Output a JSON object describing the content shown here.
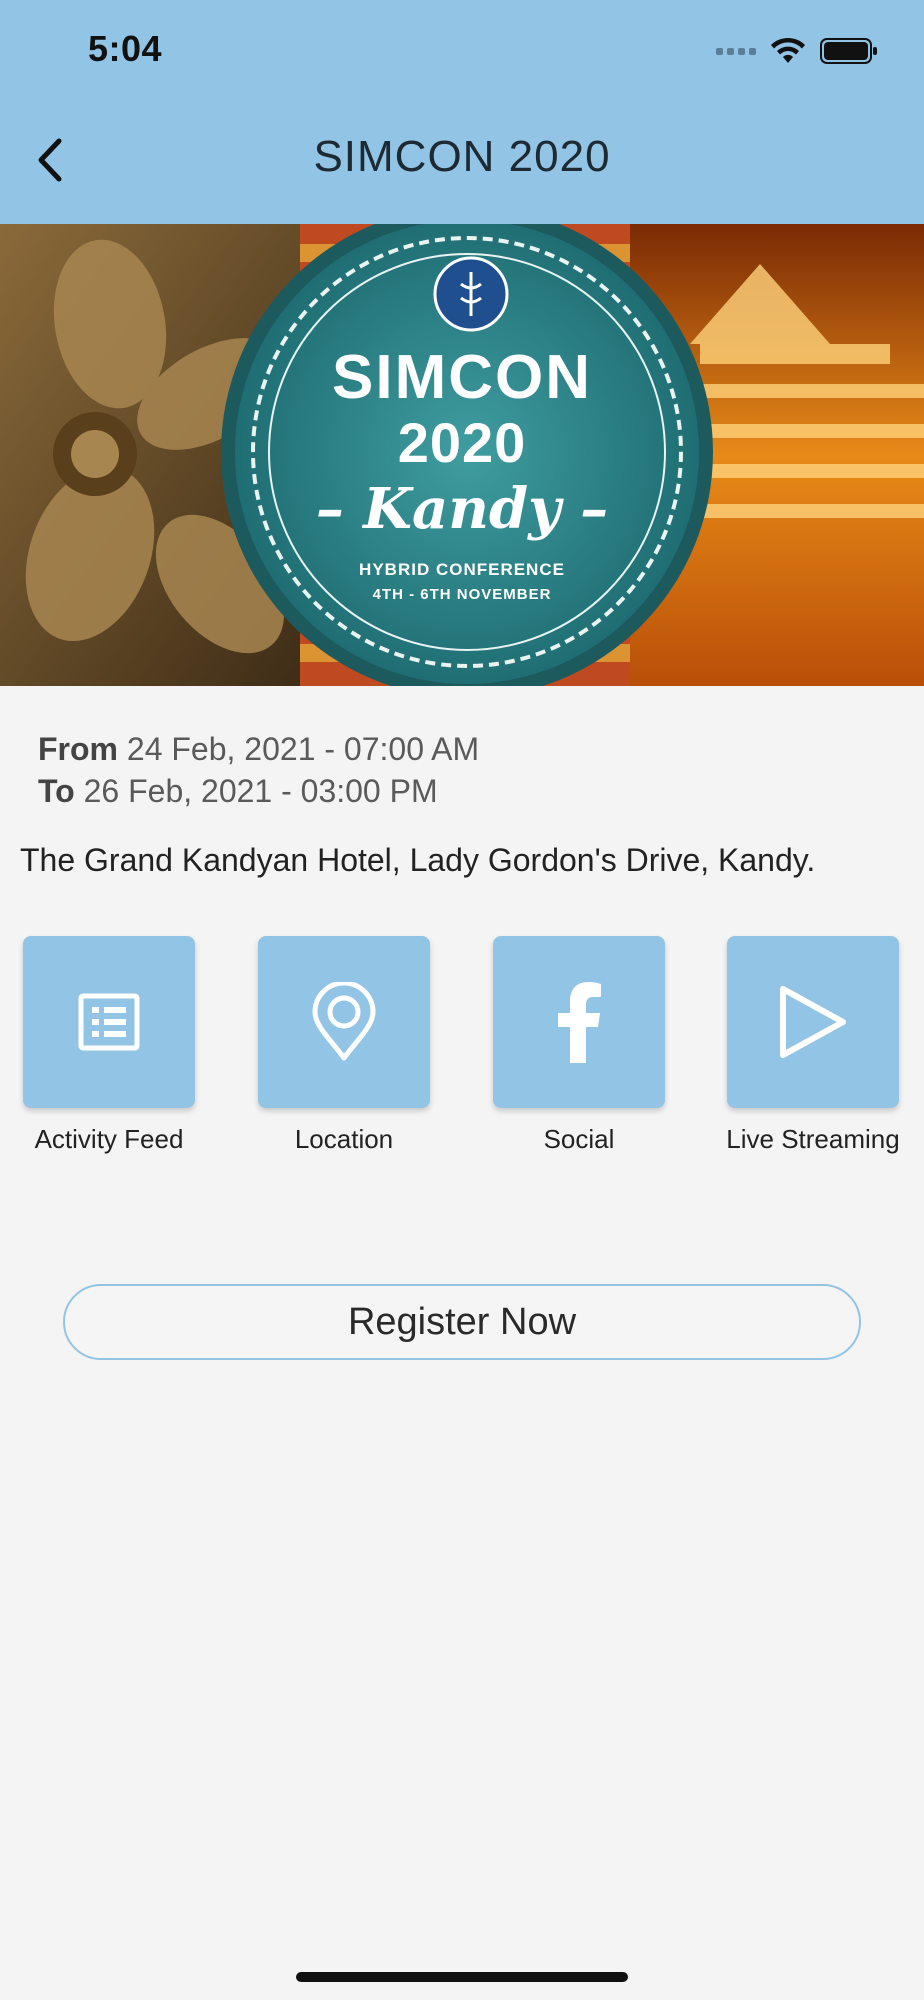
{
  "status_bar": {
    "time": "5:04"
  },
  "nav": {
    "title": "SIMCON 2020",
    "back_icon": "chevron-left-icon"
  },
  "banner": {
    "line1": "SIMCON",
    "line2": "2020",
    "line3": "– Kandy –",
    "line4": "HYBRID CONFERENCE",
    "line5": "4TH - 6TH NOVEMBER",
    "colors": {
      "ring": "#2f8a8e",
      "left": "#6b4a22",
      "right": "#e07a10"
    }
  },
  "event": {
    "from_label": "From",
    "from_value": "24 Feb, 2021 - 07:00 AM",
    "to_label": "To",
    "to_value": "26 Feb, 2021 - 03:00 PM",
    "venue": "The Grand Kandyan Hotel, Lady Gordon's Drive, Kandy."
  },
  "actions": [
    {
      "label": "Activity Feed",
      "icon": "list-icon"
    },
    {
      "label": "Location",
      "icon": "map-pin-icon"
    },
    {
      "label": "Social",
      "icon": "facebook-icon"
    },
    {
      "label": "Live Streaming",
      "icon": "play-icon"
    }
  ],
  "register_label": "Register Now",
  "theme": {
    "accent": "#92c4e6",
    "background": "#f4f4f4"
  }
}
